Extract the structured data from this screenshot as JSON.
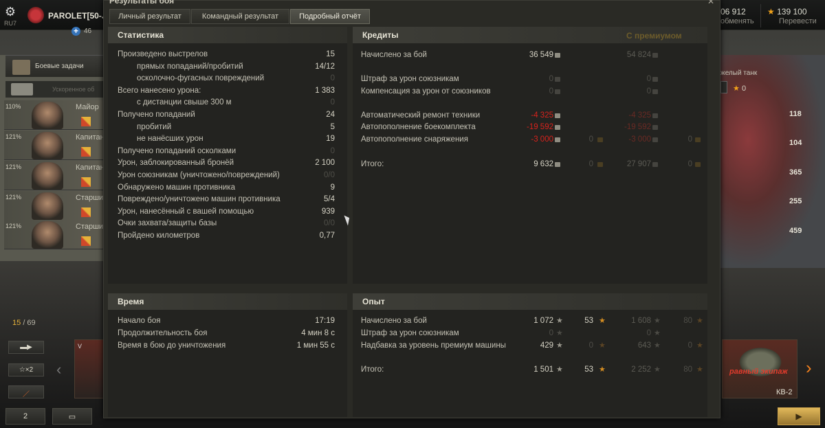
{
  "topbar": {
    "region": "RU7",
    "player_name": "PAROLET[50-J",
    "premium_plus_value": "46",
    "credits": "06 912",
    "credits_action": "обменять",
    "gold": "139 100",
    "gold_action": "Перевести"
  },
  "left_panel": {
    "missions_label": "Боевые задачи",
    "accelerated_label": "Ускоренное об",
    "crew": [
      {
        "pct": "110%",
        "rank": "Майор"
      },
      {
        "pct": "121%",
        "rank": "Капитан"
      },
      {
        "pct": "121%",
        "rank": "Капитан"
      },
      {
        "pct": "121%",
        "rank": "Старшина"
      },
      {
        "pct": "121%",
        "rank": "Старшина"
      }
    ],
    "counter_current": "15",
    "counter_total": "/ 69",
    "x2_label": "☆×2",
    "friends_count": "2",
    "tank_card_label": "V"
  },
  "right_panel": {
    "tank_type": "желый танк",
    "star_value": "0",
    "numbers": [
      "118",
      "104",
      "365",
      "255",
      "459"
    ],
    "crew_label": "равный экипаж",
    "tank_name": "КВ-2"
  },
  "window": {
    "title": "Результаты боя",
    "close": "✕",
    "tabs": [
      "Личный результат",
      "Командный результат",
      "Подробный отчёт"
    ],
    "active_tab": 2
  },
  "stats": {
    "title": "Статистика",
    "rows": [
      {
        "label": "Произведено выстрелов",
        "value": "15",
        "indent": false,
        "dim": false
      },
      {
        "label": "прямых попаданий/пробитий",
        "value": "14/12",
        "indent": true,
        "dim": false
      },
      {
        "label": "осколочно-фугасных повреждений",
        "value": "0",
        "indent": true,
        "dim": true
      },
      {
        "label": "Всего нанесено урона:",
        "value": "1 383",
        "indent": false,
        "dim": false
      },
      {
        "label": "с дистанции свыше 300 м",
        "value": "0",
        "indent": true,
        "dim": true
      },
      {
        "label": "Получено попаданий",
        "value": "24",
        "indent": false,
        "dim": false
      },
      {
        "label": "пробитий",
        "value": "5",
        "indent": true,
        "dim": false
      },
      {
        "label": "не нанёсших урон",
        "value": "19",
        "indent": true,
        "dim": false
      },
      {
        "label": "Получено попаданий осколками",
        "value": "0",
        "indent": false,
        "dim": true
      },
      {
        "label": "Урон, заблокированный бронёй",
        "value": "2 100",
        "indent": false,
        "dim": false
      },
      {
        "label": "Урон союзникам (уничтожено/повреждений)",
        "value": "0/0",
        "indent": false,
        "dim": true
      },
      {
        "label": "Обнаружено машин противника",
        "value": "9",
        "indent": false,
        "dim": false
      },
      {
        "label": "Повреждено/уничтожено машин противника",
        "value": "5/4",
        "indent": false,
        "dim": false
      },
      {
        "label": "Урон, нанесённый с вашей помощью",
        "value": "939",
        "indent": false,
        "dim": false
      },
      {
        "label": "Очки захвата/защиты базы",
        "value": "0/0",
        "indent": false,
        "dim": true
      },
      {
        "label": "Пройдено километров",
        "value": "0,77",
        "indent": false,
        "dim": false
      }
    ]
  },
  "credits": {
    "title": "Кредиты",
    "premium_label": "С премиумом",
    "rows": [
      {
        "label": "Начислено за бой",
        "v1": "36 549",
        "v2": "",
        "v3": "54 824",
        "v4": "",
        "style": "normal"
      },
      {
        "label": "Штраф за урон союзникам",
        "v1": "0",
        "v2": "",
        "v3": "0",
        "v4": "",
        "style": "dim"
      },
      {
        "label": "Компенсация за урон от союзников",
        "v1": "0",
        "v2": "",
        "v3": "0",
        "v4": "",
        "style": "dim"
      },
      {
        "label": "Автоматический ремонт техники",
        "v1": "-4 325",
        "v2": "",
        "v3": "-4 325",
        "v4": "",
        "style": "red"
      },
      {
        "label": "Автопополнение боекомплекта",
        "v1": "-19 592",
        "v2": "",
        "v3": "-19 592",
        "v4": "",
        "style": "red"
      },
      {
        "label": "Автопополнение снаряжения",
        "v1": "-3 000",
        "v2": "0",
        "v3": "-3 000",
        "v4": "0",
        "style": "red"
      },
      {
        "label": "Итого:",
        "v1": "9 632",
        "v2": "0",
        "v3": "27 907",
        "v4": "0",
        "style": "total"
      }
    ]
  },
  "time": {
    "title": "Время",
    "rows": [
      {
        "label": "Начало боя",
        "value": "17:19"
      },
      {
        "label": "Продолжительность боя",
        "value": "4 мин 8 с"
      },
      {
        "label": "Время в бою до уничтожения",
        "value": "1 мин 55 с"
      }
    ]
  },
  "experience": {
    "title": "Опыт",
    "rows": [
      {
        "label": "Начислено за бой",
        "v1": "1 072",
        "v2": "53",
        "v3": "1 608",
        "v4": "80",
        "style": "normal"
      },
      {
        "label": "Штраф за урон союзникам",
        "v1": "0",
        "v2": "",
        "v3": "0",
        "v4": "",
        "style": "dim"
      },
      {
        "label": "Надбавка за уровень премиум машины",
        "v1": "429",
        "v2": "0",
        "v3": "643",
        "v4": "0",
        "style": "normal"
      },
      {
        "label": "Итого:",
        "v1": "1 501",
        "v2": "53",
        "v3": "2 252",
        "v4": "80",
        "style": "total"
      }
    ]
  }
}
